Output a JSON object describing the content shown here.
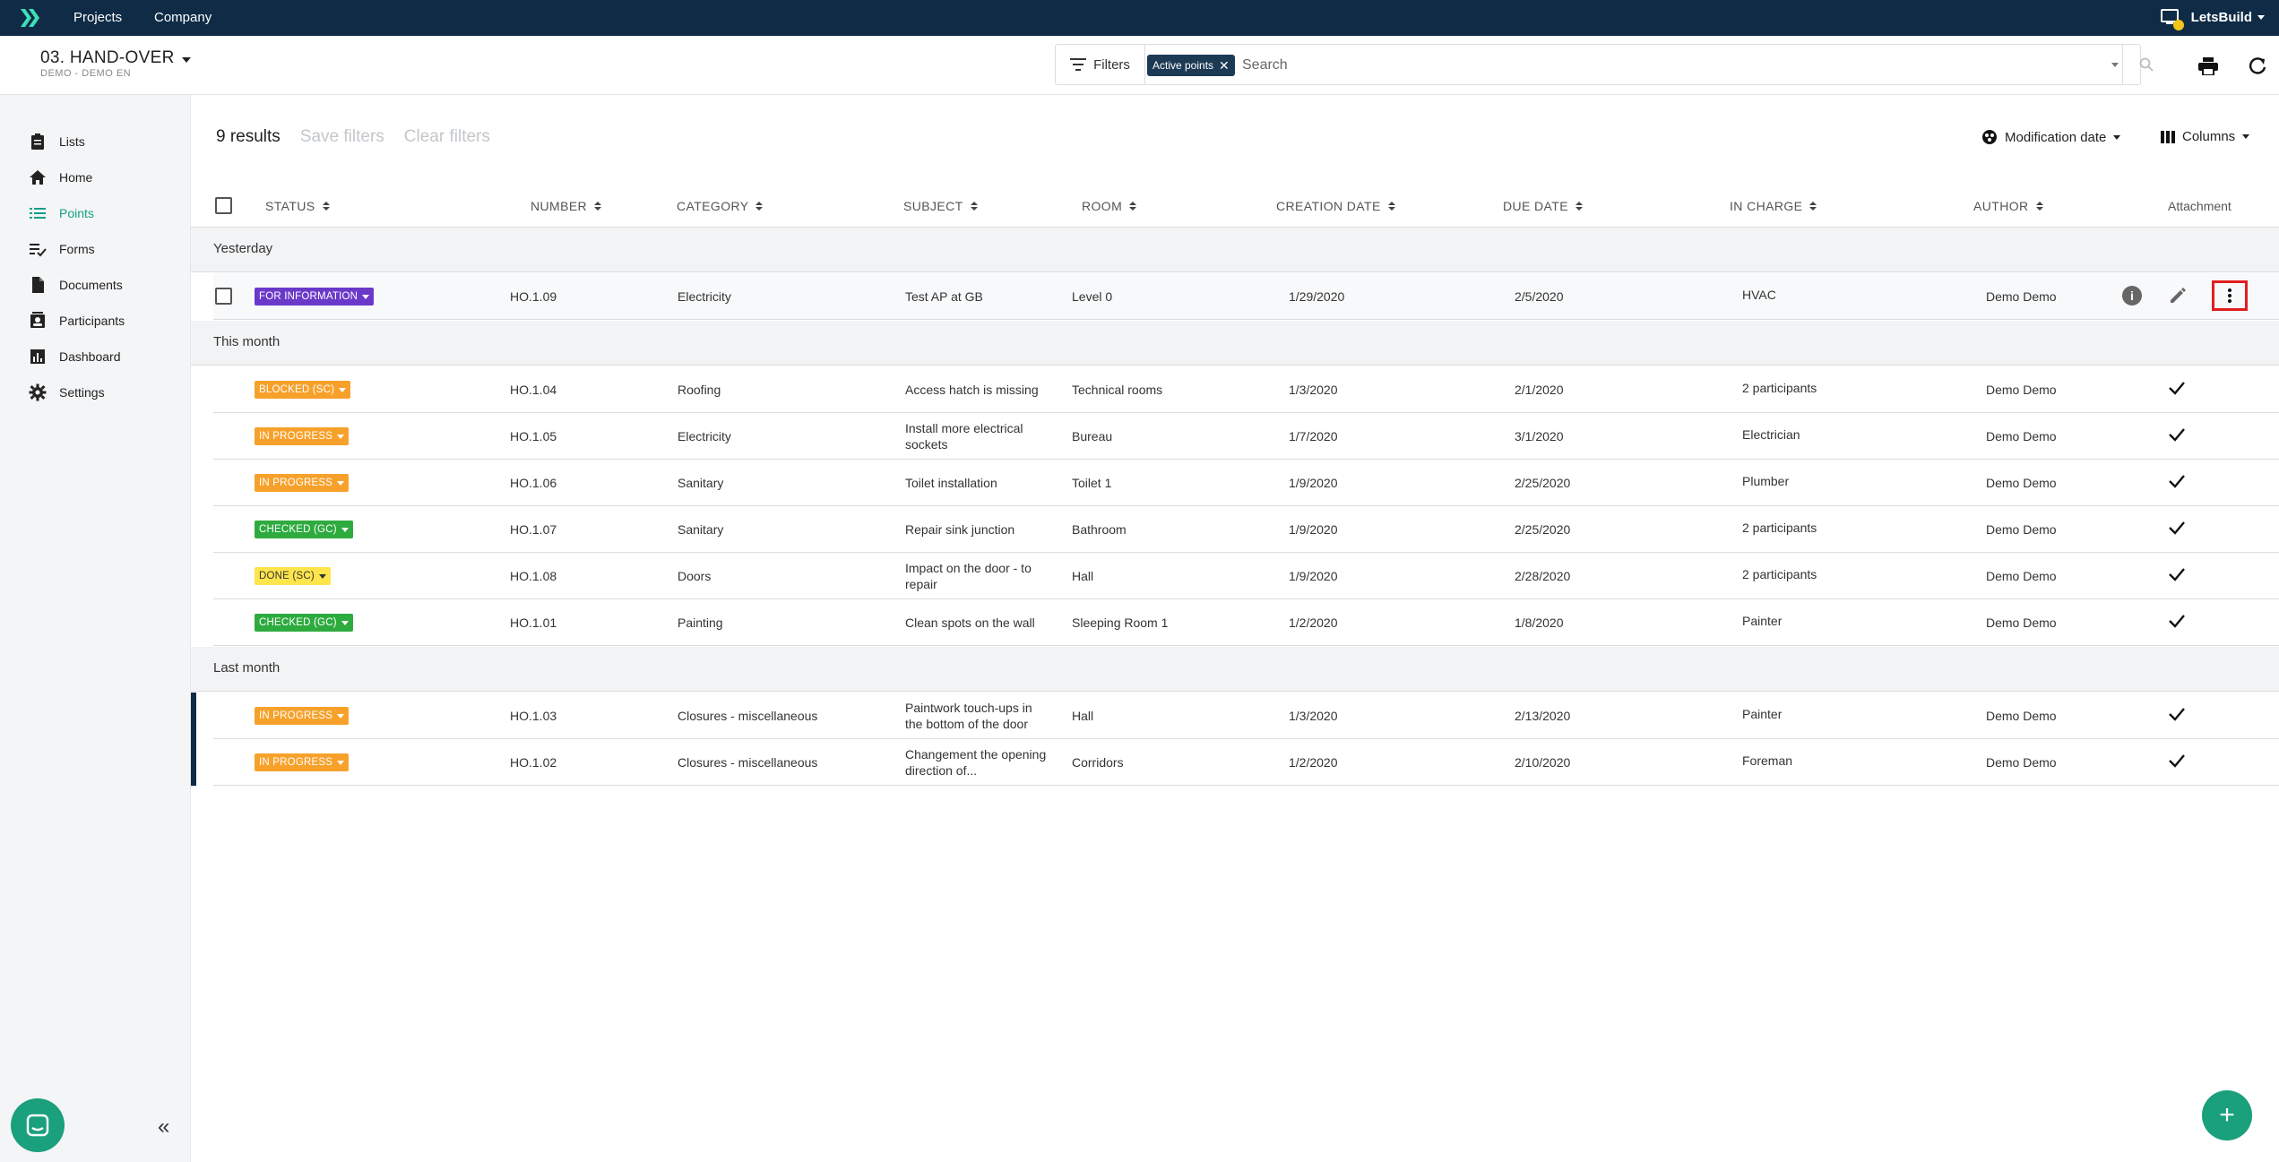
{
  "topbar": {
    "nav": [
      "Projects",
      "Company"
    ],
    "user": "LetsBuild"
  },
  "project": {
    "title": "03. HAND-OVER",
    "subtitle": "DEMO - DEMO EN"
  },
  "filters": {
    "label": "Filters",
    "active_chip": "Active points",
    "search_placeholder": "Search"
  },
  "sidebar": {
    "items": [
      {
        "label": "Lists",
        "icon": "clipboard-icon"
      },
      {
        "label": "Home",
        "icon": "home-icon"
      },
      {
        "label": "Points",
        "icon": "list-icon",
        "active": true
      },
      {
        "label": "Forms",
        "icon": "checklist-icon"
      },
      {
        "label": "Documents",
        "icon": "document-icon"
      },
      {
        "label": "Participants",
        "icon": "contact-card-icon"
      },
      {
        "label": "Dashboard",
        "icon": "bar-chart-icon"
      },
      {
        "label": "Settings",
        "icon": "gear-icon"
      }
    ]
  },
  "toolbar": {
    "results": "9 results",
    "save_filters": "Save filters",
    "clear_filters": "Clear filters",
    "sort_label": "Modification date",
    "columns_label": "Columns"
  },
  "columns": {
    "status": "STATUS",
    "number": "NUMBER",
    "category": "CATEGORY",
    "subject": "SUBJECT",
    "room": "ROOM",
    "creation_date": "CREATION DATE",
    "due_date": "DUE DATE",
    "in_charge": "IN CHARGE",
    "author": "AUTHOR",
    "attachment": "Attachment"
  },
  "groups": {
    "yesterday": "Yesterday",
    "this_month": "This month",
    "last_month": "Last month"
  },
  "rows": [
    {
      "status": "FOR INFORMATION",
      "color": "#6b39c9",
      "number": "HO.1.09",
      "category": "Electricity",
      "subject": "Test AP at GB",
      "room": "Level 0",
      "created": "1/29/2020",
      "due": "2/5/2020",
      "in_charge": "HVAC",
      "author": "Demo Demo",
      "attachment": false
    },
    {
      "status": "BLOCKED (SC)",
      "color": "#f7a12b",
      "number": "HO.1.04",
      "category": "Roofing",
      "subject": "Access hatch is missing",
      "room": "Technical rooms",
      "created": "1/3/2020",
      "due": "2/1/2020",
      "in_charge": "2 participants",
      "author": "Demo Demo",
      "attachment": true
    },
    {
      "status": "IN PROGRESS",
      "color": "#f7a12b",
      "number": "HO.1.05",
      "category": "Electricity",
      "subject": "Install more electrical sockets",
      "room": "Bureau",
      "created": "1/7/2020",
      "due": "3/1/2020",
      "in_charge": "Electrician",
      "author": "Demo Demo",
      "attachment": true
    },
    {
      "status": "IN PROGRESS",
      "color": "#f7a12b",
      "number": "HO.1.06",
      "category": "Sanitary",
      "subject": "Toilet installation",
      "room": "Toilet 1",
      "created": "1/9/2020",
      "due": "2/25/2020",
      "in_charge": "Plumber",
      "author": "Demo Demo",
      "attachment": true
    },
    {
      "status": "CHECKED (GC)",
      "color": "#2eab3f",
      "number": "HO.1.07",
      "category": "Sanitary",
      "subject": "Repair sink junction",
      "room": "Bathroom",
      "created": "1/9/2020",
      "due": "2/25/2020",
      "in_charge": "2 participants",
      "author": "Demo Demo",
      "attachment": true
    },
    {
      "status": "DONE (SC)",
      "color": "#ffe54c",
      "number": "HO.1.08",
      "category": "Doors",
      "subject": "Impact on the door - to repair",
      "room": "Hall",
      "created": "1/9/2020",
      "due": "2/28/2020",
      "in_charge": "2 participants",
      "author": "Demo Demo",
      "attachment": true
    },
    {
      "status": "CHECKED (GC)",
      "color": "#2eab3f",
      "number": "HO.1.01",
      "category": "Painting",
      "subject": "Clean spots on the wall",
      "room": "Sleeping Room 1",
      "created": "1/2/2020",
      "due": "1/8/2020",
      "in_charge": "Painter",
      "author": "Demo Demo",
      "attachment": true
    },
    {
      "status": "IN PROGRESS",
      "color": "#f7a12b",
      "number": "HO.1.03",
      "category": "Closures - miscellaneous",
      "subject": "Paintwork touch-ups in the bottom of the door",
      "room": "Hall",
      "created": "1/3/2020",
      "due": "2/13/2020",
      "in_charge": "Painter",
      "author": "Demo Demo",
      "attachment": true
    },
    {
      "status": "IN PROGRESS",
      "color": "#f7a12b",
      "number": "HO.1.02",
      "category": "Closures - miscellaneous",
      "subject": "Changement the opening direction of...",
      "room": "Corridors",
      "created": "1/2/2020",
      "due": "2/10/2020",
      "in_charge": "Foreman",
      "author": "Demo Demo",
      "attachment": true
    }
  ]
}
